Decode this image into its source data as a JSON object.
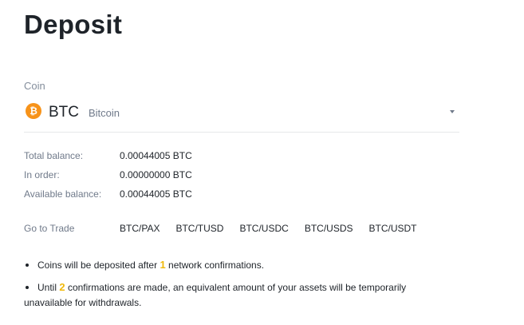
{
  "page": {
    "title": "Deposit"
  },
  "coin": {
    "label": "Coin",
    "icon": "bitcoin-icon",
    "icon_glyph": "₿",
    "symbol": "BTC",
    "name": "Bitcoin"
  },
  "balances": [
    {
      "label": "Total balance:",
      "value": "0.00044005 BTC"
    },
    {
      "label": "In order:",
      "value": "0.00000000 BTC"
    },
    {
      "label": "Available balance:",
      "value": "0.00044005 BTC"
    }
  ],
  "trade": {
    "label": "Go to Trade",
    "pairs": [
      "BTC/PAX",
      "BTC/TUSD",
      "BTC/USDC",
      "BTC/USDS",
      "BTC/USDT"
    ]
  },
  "notes": {
    "n1_pre": "Coins will be deposited after",
    "n1_num": "1",
    "n1_post": "network confirmations.",
    "n2_pre": "Until",
    "n2_num": "2",
    "n2_post": "confirmations are made, an equivalent amount of your assets will be temporarily unavailable for withdrawals."
  },
  "colors": {
    "accent": "#f0b90b",
    "bitcoin": "#f7931a",
    "text": "#1e2329",
    "muted": "#707a8a"
  }
}
